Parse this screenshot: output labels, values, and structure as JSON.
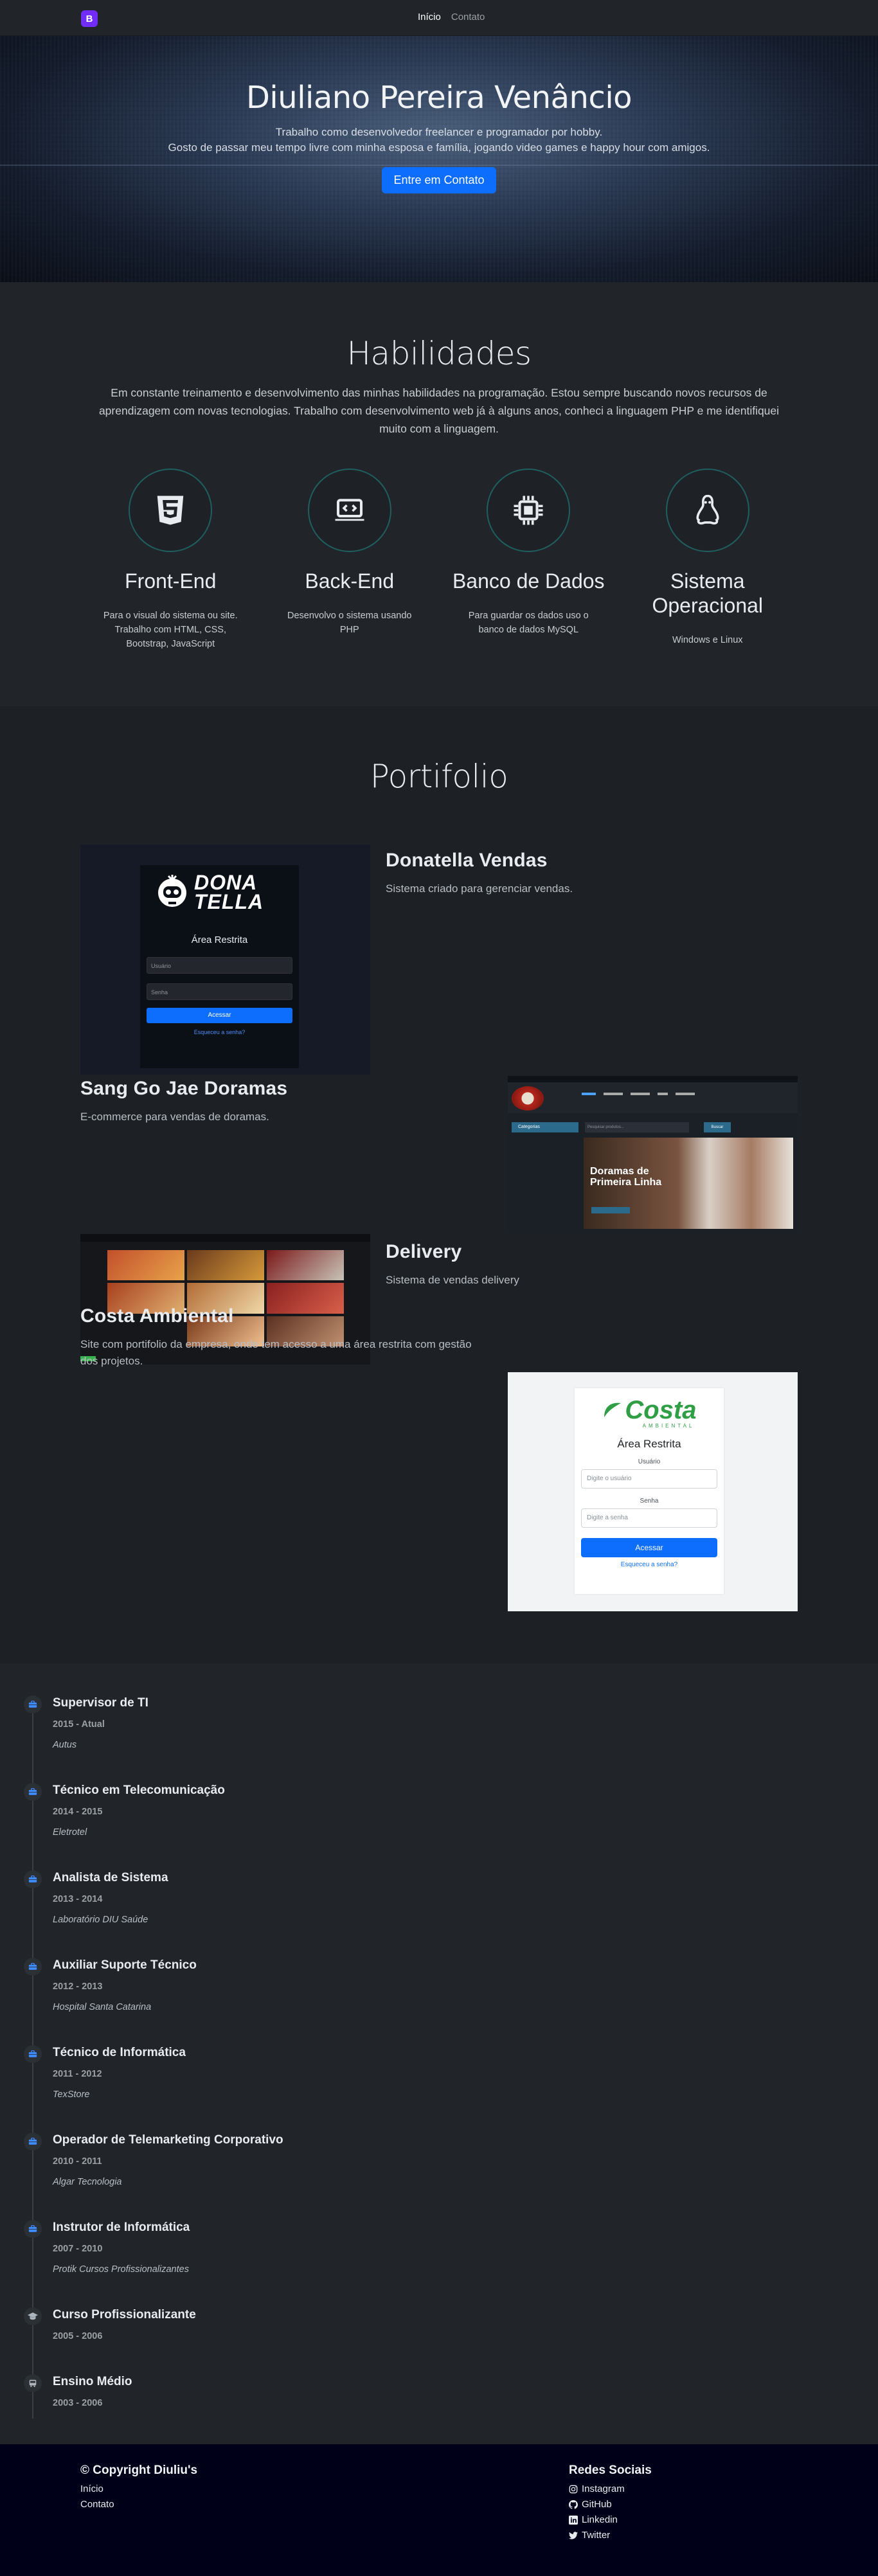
{
  "nav": {
    "brand": "B",
    "links": [
      "Início",
      "Contato"
    ]
  },
  "hero": {
    "title": "Diuliano Pereira Venâncio",
    "line1": "Trabalho como desenvolvedor freelancer e programador por hobby.",
    "line2": "Gosto de passar meu tempo livre com minha esposa e família, jogando video games e happy hour com amigos.",
    "cta": "Entre em Contato"
  },
  "skills": {
    "title": "Habilidades",
    "intro": "Em constante treinamento e desenvolvimento das minhas habilidades na programação. Estou sempre buscando novos recursos de aprendizagem com novas tecnologias. Trabalho com desenvolvimento web já à alguns anos, conheci a linguagem PHP e me identifiquei muito com a linguagem.",
    "items": [
      {
        "title": "Front-End",
        "text": "Para o visual do sistema ou site. Trabalho com HTML, CSS, Bootstrap, JavaScript",
        "icon": "css3-icon"
      },
      {
        "title": "Back-End",
        "text": "Desenvolvo o sistema usando PHP",
        "icon": "code-laptop-icon"
      },
      {
        "title": "Banco de Dados",
        "text": "Para guardar os dados uso o banco de dados MySQL",
        "icon": "cpu-icon"
      },
      {
        "title": "Sistema Operacional",
        "text": "Windows e Linux",
        "icon": "linux-icon"
      }
    ]
  },
  "portfolio": {
    "title": "Portifolio",
    "items": [
      {
        "title": "Donatella Vendas",
        "desc": "Sistema criado para gerenciar vendas."
      },
      {
        "title": "Sang Go Jae Doramas",
        "desc": "E-commerce para vendas de doramas."
      },
      {
        "title": "Delivery",
        "desc": "Sistema de vendas delivery"
      },
      {
        "title": "Costa Ambiental",
        "desc": "Site com portifolio da empresa, onde tem acesso a uma área restrita com gestão dos projetos."
      }
    ],
    "donatella": {
      "logo1": "DONA",
      "logo2": "TELLA",
      "area": "Área Restrita",
      "user": "Usuário",
      "pass": "Senha",
      "btn": "Acessar",
      "forgot": "Esqueceu a senha?"
    },
    "doramas": {
      "search": "Pesquisar produtos...",
      "btn": "Buscar",
      "menu": "Categorias",
      "hero1": "Doramas de",
      "hero2": "Primeira Linha"
    },
    "costa": {
      "logo": "Costa",
      "sub": "AMBIENTAL",
      "area": "Área Restrita",
      "user_label": "Usuário",
      "user_ph": "Digite o usuário",
      "pass_label": "Senha",
      "pass_ph": "Digite a senha",
      "btn": "Acessar",
      "forgot": "Esqueceu a senha?"
    }
  },
  "timeline": [
    {
      "title": "Supervisor de TI",
      "years": "2015 - Atual",
      "company": "Autus",
      "icon": "briefcase-icon"
    },
    {
      "title": "Técnico em Telecomunicação",
      "years": "2014 - 2015",
      "company": "Eletrotel",
      "icon": "briefcase-icon"
    },
    {
      "title": "Analista de Sistema",
      "years": "2013 - 2014",
      "company": "Laboratório DIU Saúde",
      "icon": "briefcase-icon"
    },
    {
      "title": "Auxiliar Suporte Técnico",
      "years": "2012 - 2013",
      "company": "Hospital Santa Catarina",
      "icon": "briefcase-icon"
    },
    {
      "title": "Técnico de Informática",
      "years": "2011 - 2012",
      "company": "TexStore",
      "icon": "briefcase-icon"
    },
    {
      "title": "Operador de Telemarketing Corporativo",
      "years": "2010 - 2011",
      "company": "Algar Tecnologia",
      "icon": "briefcase-icon"
    },
    {
      "title": "Instrutor de Informática",
      "years": "2007 - 2010",
      "company": "Protik Cursos Profissionalizantes",
      "icon": "briefcase-icon"
    },
    {
      "title": "Curso Profissionalizante",
      "years": "2005 - 2006",
      "company": "",
      "icon": "graduation-cap-icon"
    },
    {
      "title": "Ensino Médio",
      "years": "2003 - 2006",
      "company": "",
      "icon": "school-bus-icon"
    }
  ],
  "footer": {
    "copyright": "© Copyright Diuliu's",
    "links": [
      "Início",
      "Contato"
    ],
    "social_title": "Redes Sociais",
    "social": [
      "Instagram",
      "GitHub",
      "Linkedin",
      "Twitter"
    ]
  }
}
